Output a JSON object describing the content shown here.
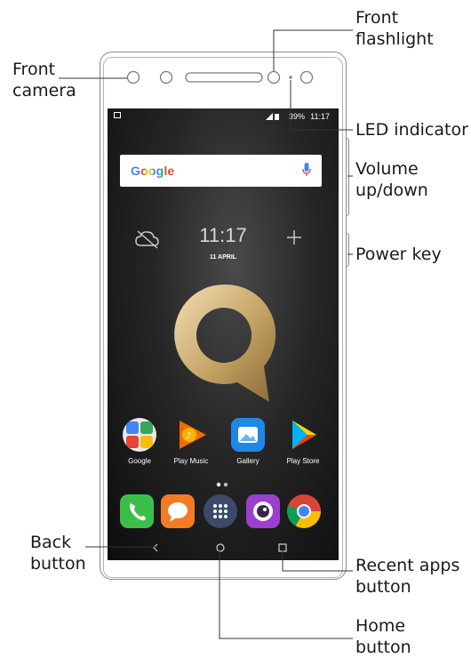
{
  "callouts": {
    "front_camera": [
      "Front",
      "camera"
    ],
    "front_flashlight": [
      "Front",
      "flashlight"
    ],
    "led_indicator": [
      "LED indicator"
    ],
    "volume": [
      "Volume",
      "up/down"
    ],
    "power_key": [
      "Power key"
    ],
    "back_button": [
      "Back",
      "button"
    ],
    "recent_apps": [
      "Recent apps",
      "button"
    ],
    "home_button": [
      "Home",
      "button"
    ]
  },
  "screen": {
    "status_battery": "39%",
    "status_time": "11:17",
    "search_logo": "Google",
    "clock_time": "11:17",
    "clock_date": "11 APRIL",
    "apps": [
      {
        "label": "Google",
        "icon": "google-folder-icon"
      },
      {
        "label": "Play Music",
        "icon": "play-music-icon"
      },
      {
        "label": "Gallery",
        "icon": "gallery-icon"
      },
      {
        "label": "Play Store",
        "icon": "play-store-icon"
      }
    ],
    "dock": [
      {
        "icon": "phone-icon",
        "color": "#3cbf4a"
      },
      {
        "icon": "messages-icon",
        "color": "#f47a25"
      },
      {
        "icon": "app-drawer-icon",
        "color": "#3b4a6b"
      },
      {
        "icon": "camera-app-icon",
        "color": "#9b3fcf"
      },
      {
        "icon": "chrome-icon",
        "color": "#db4437"
      }
    ]
  },
  "colors": {
    "accent_gold": "#c9a86a",
    "frame": "#8a8a8a"
  }
}
